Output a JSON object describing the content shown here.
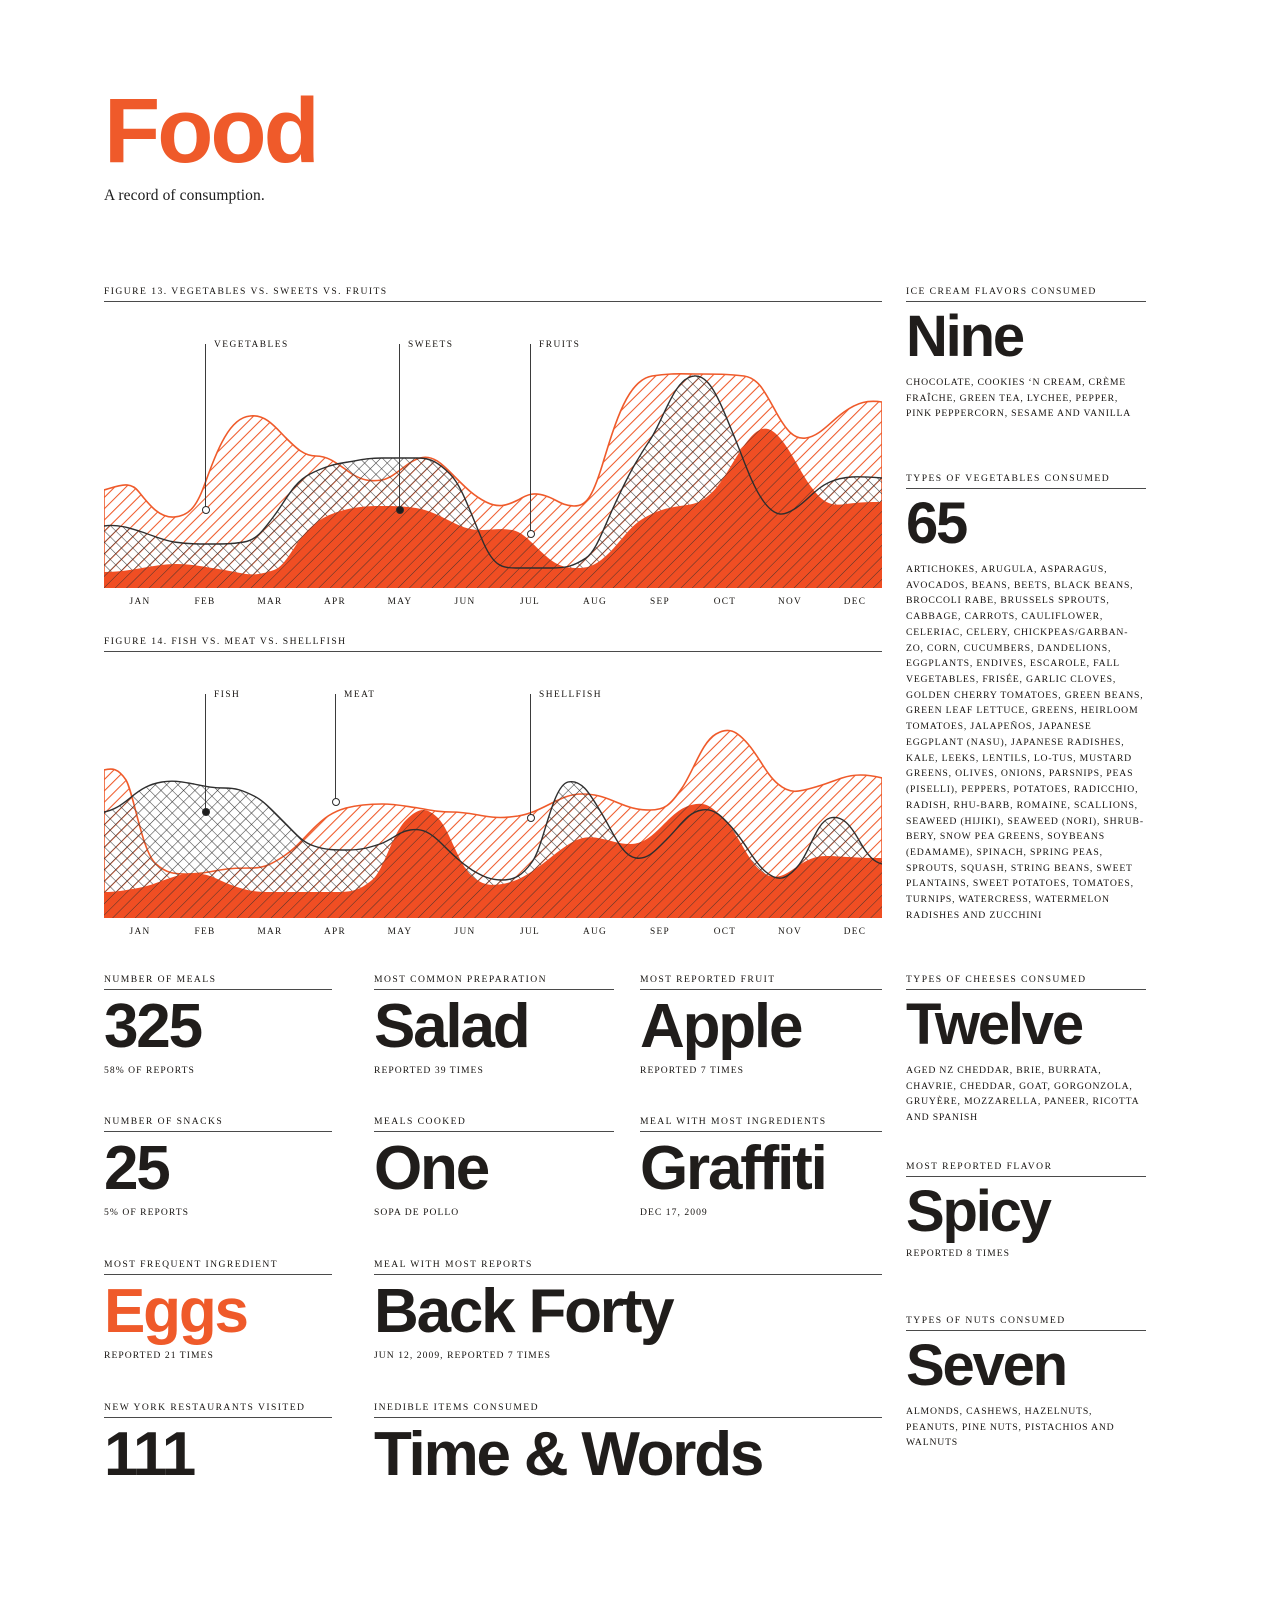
{
  "masthead": {
    "title": "Food",
    "tagline": "A record of consumption."
  },
  "colors": {
    "accent": "#ef5a2a",
    "solid_fill": "#f04e23",
    "ink": "#201d1b",
    "rule": "#4a4a4a"
  },
  "figures": [
    {
      "title": "FIGURE 13. VEGETABLES VS. SWEETS VS. FRUITS",
      "callouts": [
        {
          "label": "VEGETABLES",
          "dot": "hollow"
        },
        {
          "label": "SWEETS",
          "dot": "filled"
        },
        {
          "label": "FRUITS",
          "dot": "hollow"
        }
      ]
    },
    {
      "title": "FIGURE 14. FISH VS. MEAT VS. SHELLFISH",
      "callouts": [
        {
          "label": "FISH",
          "dot": "filled"
        },
        {
          "label": "MEAT",
          "dot": "hollow"
        },
        {
          "label": "SHELLFISH",
          "dot": "hollow"
        }
      ]
    }
  ],
  "months": [
    "JAN",
    "FEB",
    "MAR",
    "APR",
    "MAY",
    "JUN",
    "JUL",
    "AUG",
    "SEP",
    "OCT",
    "NOV",
    "DEC"
  ],
  "chart_data": [
    {
      "type": "area",
      "title": "FIGURE 13. VEGETABLES VS. SWEETS VS. FRUITS",
      "xlabel": "",
      "ylabel": "",
      "x": [
        "JAN",
        "FEB",
        "MAR",
        "APR",
        "MAY",
        "JUN",
        "JUL",
        "AUG",
        "SEP",
        "OCT",
        "NOV",
        "DEC"
      ],
      "ylim": [
        0,
        100
      ],
      "grid": false,
      "legend": "inline-callouts",
      "series": [
        {
          "name": "VEGETABLES",
          "style": "orange-hatch",
          "values": [
            36,
            26,
            62,
            52,
            42,
            50,
            30,
            36,
            88,
            96,
            72,
            80
          ]
        },
        {
          "name": "SWEETS",
          "style": "dark-hatch",
          "values": [
            22,
            16,
            12,
            30,
            40,
            40,
            8,
            8,
            24,
            96,
            48,
            46
          ]
        },
        {
          "name": "FRUITS",
          "style": "solid-orange",
          "values": [
            6,
            10,
            6,
            30,
            34,
            32,
            24,
            10,
            28,
            66,
            42,
            46
          ]
        }
      ]
    },
    {
      "type": "area",
      "title": "FIGURE 14. FISH VS. MEAT VS. SHELLFISH",
      "xlabel": "",
      "ylabel": "",
      "x": [
        "JAN",
        "FEB",
        "MAR",
        "APR",
        "MAY",
        "JUN",
        "JUL",
        "AUG",
        "SEP",
        "OCT",
        "NOV",
        "DEC"
      ],
      "ylim": [
        0,
        100
      ],
      "grid": false,
      "legend": "inline-callouts",
      "series": [
        {
          "name": "FISH",
          "style": "dark-hatch",
          "values": [
            30,
            44,
            42,
            16,
            12,
            14,
            24,
            26,
            58,
            44,
            16,
            44
          ]
        },
        {
          "name": "MEAT",
          "style": "orange-hatch",
          "values": [
            86,
            14,
            12,
            34,
            52,
            50,
            46,
            52,
            40,
            88,
            58,
            62
          ]
        },
        {
          "name": "SHELLFISH",
          "style": "solid-orange",
          "values": [
            6,
            14,
            12,
            10,
            10,
            28,
            50,
            12,
            26,
            42,
            14,
            24
          ]
        }
      ]
    }
  ],
  "stats_left": [
    {
      "label": "NUMBER OF MEALS",
      "value": "325",
      "sub": "58% OF REPORTS",
      "size": 62,
      "color": "ink"
    },
    {
      "label": "NUMBER OF SNACKS",
      "value": "25",
      "sub": "5% OF REPORTS",
      "size": 62,
      "color": "ink"
    },
    {
      "label": "MOST FREQUENT INGREDIENT",
      "value": "Eggs",
      "sub": "REPORTED 21 TIMES",
      "size": 62,
      "color": "accent"
    },
    {
      "label": "NEW YORK RESTAURANTS VISITED",
      "value": "111",
      "sub": "",
      "size": 62,
      "color": "ink"
    }
  ],
  "stats_mid": [
    {
      "label": "MOST COMMON PREPARATION",
      "value": "Salad",
      "sub": "REPORTED 39 TIMES",
      "size": 62,
      "color": "ink"
    },
    {
      "label": "MEALS COOKED",
      "value": "One",
      "sub": "SOPA DE POLLO",
      "size": 62,
      "color": "ink"
    },
    {
      "label": "MEAL WITH MOST REPORTS",
      "value": "Back Forty",
      "sub": "JUN 12, 2009, REPORTED 7 TIMES",
      "size": 62,
      "color": "ink"
    },
    {
      "label": "INEDIBLE ITEMS CONSUMED",
      "value": "Time & Words",
      "sub": "",
      "size": 62,
      "color": "ink"
    }
  ],
  "stats_mid2": [
    {
      "label": "MOST REPORTED FRUIT",
      "value": "Apple",
      "sub": "REPORTED 7 TIMES",
      "size": 62,
      "color": "ink"
    },
    {
      "label": "MEAL WITH MOST INGREDIENTS",
      "value": "Graffiti",
      "sub": "DEC 17, 2009",
      "size": 62,
      "color": "ink"
    }
  ],
  "sidebar": [
    {
      "label": "ICE CREAM FLAVORS CONSUMED",
      "value": "Nine",
      "size": 58,
      "list": "CHOCOLATE, COOKIES ‘N CREAM, CRÈME FRAÎCHE, GREEN TEA, LYCHEE, PEPPER, PINK PEPPERCORN, SESAME AND VANILLA"
    },
    {
      "label": "TYPES OF VEGETABLES CONSUMED",
      "value": "65",
      "size": 58,
      "list": "ARTICHOKES, ARUGULA, ASPARAGUS, AVOCADOS, BEANS, BEETS, BLACK BEANS, BROCCOLI RABE, BRUSSELS SPROUTS, CABBAGE, CARROTS, CAULIFLOWER, CELERIAC, CELERY, CHICKPEAS/GARBAN-ZO, CORN, CUCUMBERS, DANDELIONS, EGGPLANTS, ENDIVES, ESCAROLE, FALL VEGETABLES, FRISÉE, GARLIC CLOVES, GOLDEN CHERRY TOMATOES, GREEN BEANS, GREEN LEAF LETTUCE, GREENS, HEIRLOOM TOMATOES, JALAPEÑOS, JAPANESE EGGPLANT (NASU), JAPANESE RADISHES, KALE, LEEKS, LENTILS, LO-TUS, MUSTARD GREENS, OLIVES, ONIONS, PARSNIPS, PEAS (PISELLI), PEPPERS, POTATOES, RADICCHIO, RADISH, RHU-BARB, ROMAINE, SCALLIONS, SEAWEED (HIJIKI), SEAWEED (NORI), SHRUB-BERY, SNOW PEA GREENS, SOYBEANS (EDAMAME), SPINACH, SPRING PEAS, SPROUTS, SQUASH, STRING BEANS, SWEET PLANTAINS, SWEET POTATOES, TOMATOES, TURNIPS, WATERCRESS, WATERMELON RADISHES AND ZUCCHINI"
    },
    {
      "label": "TYPES OF CHEESES CONSUMED",
      "value": "Twelve",
      "size": 58,
      "list": "AGED NZ CHEDDAR, BRIE, BURRATA, CHAVRIE, CHEDDAR, GOAT, GORGONZOLA, GRUYÈRE, MOZZARELLA, PANEER, RICOTTA AND SPANISH"
    },
    {
      "label": "MOST REPORTED FLAVOR",
      "value": "Spicy",
      "size": 58,
      "sub": "REPORTED 8 TIMES"
    },
    {
      "label": "TYPES OF NUTS CONSUMED",
      "value": "Seven",
      "size": 58,
      "list": "ALMONDS, CASHEWS, HAZELNUTS, PEANUTS, PINE NUTS, PISTACHIOS AND WALNUTS"
    }
  ]
}
